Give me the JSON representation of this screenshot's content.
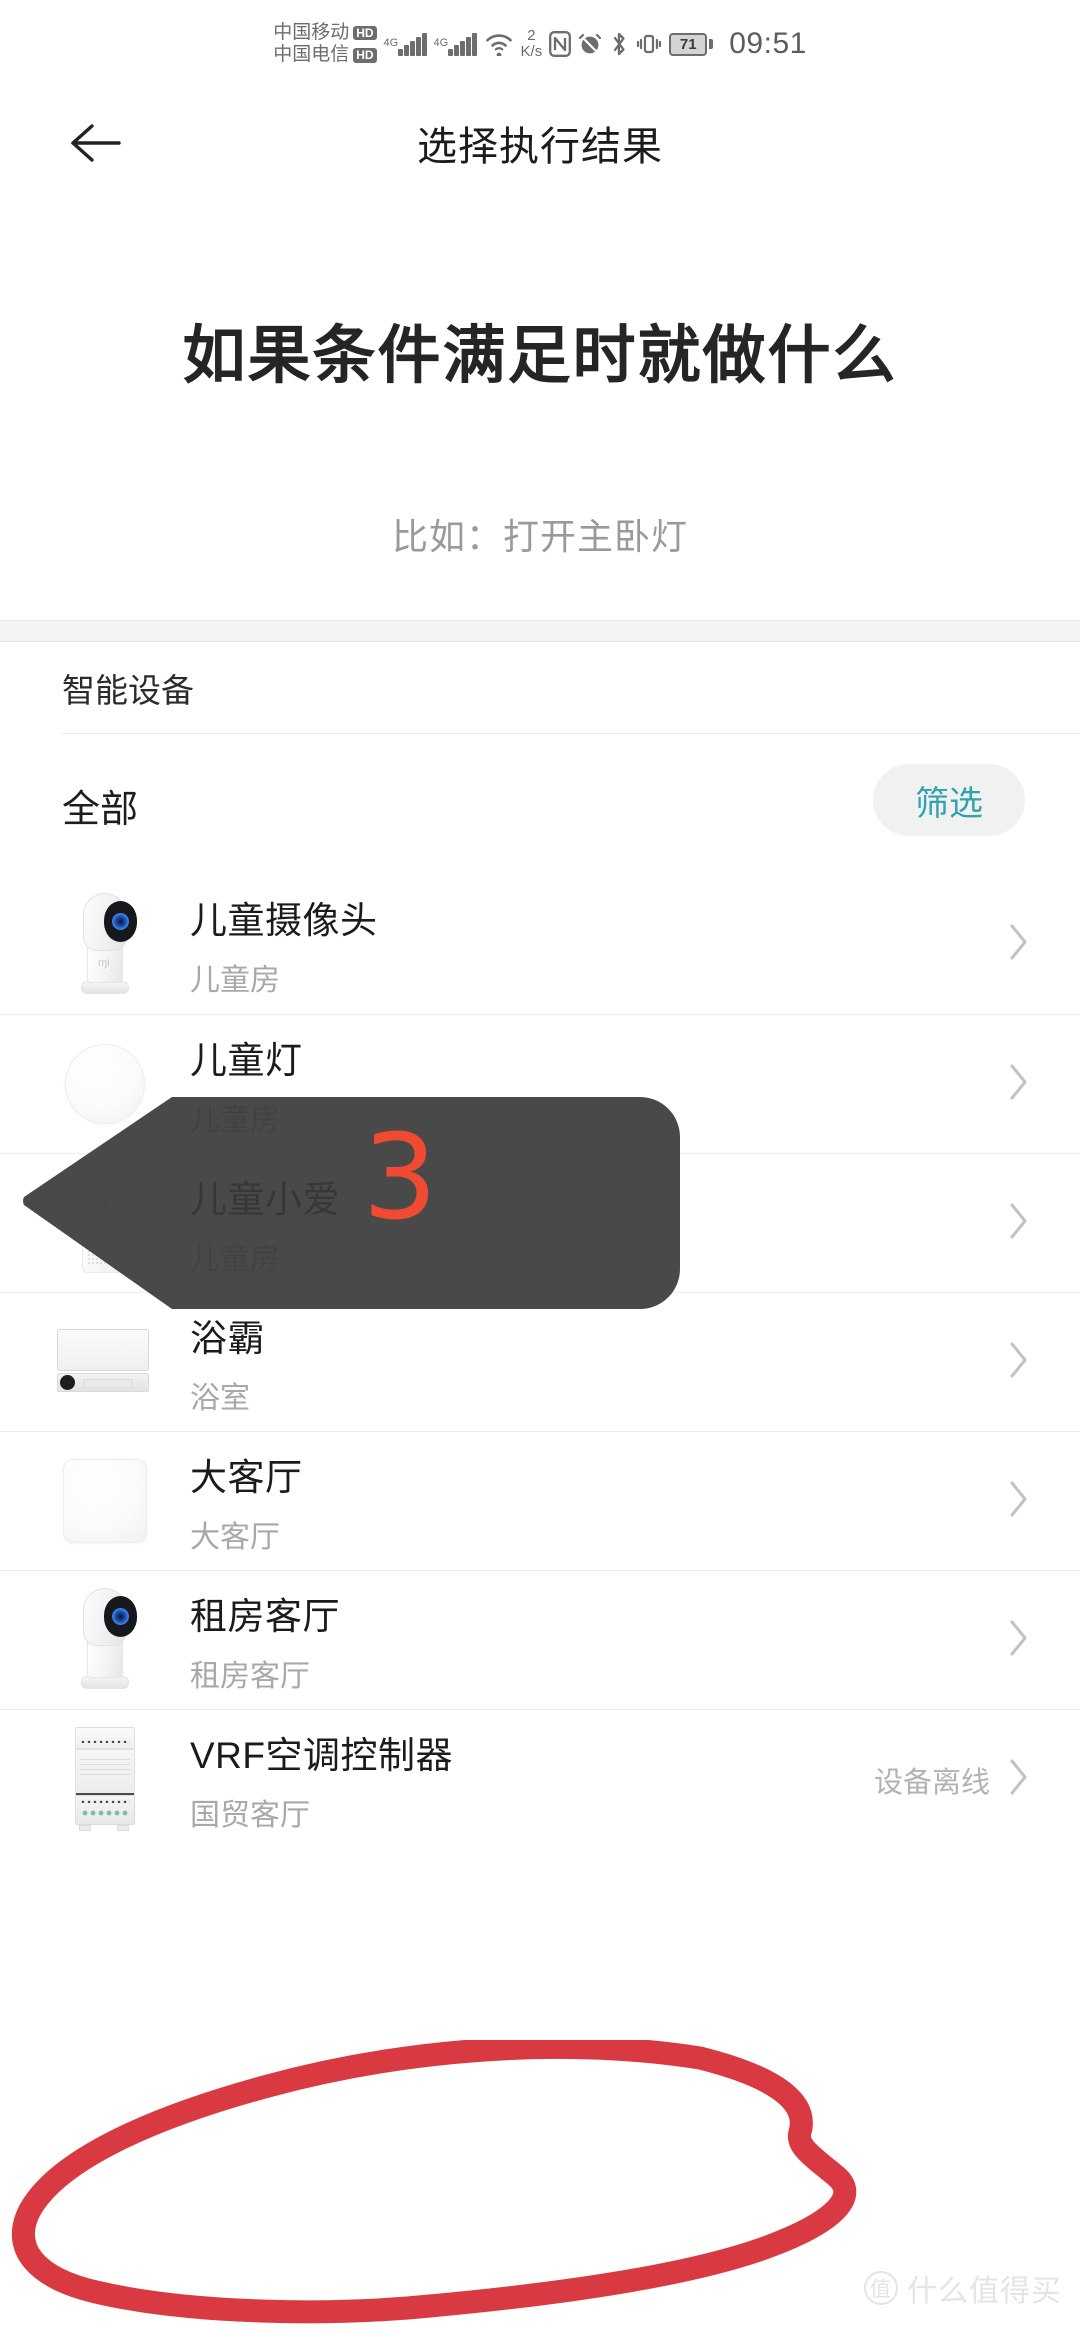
{
  "status_bar": {
    "carrier_primary": "中国移动",
    "carrier_primary_badge": "HD",
    "carrier_secondary": "中国电信",
    "carrier_secondary_badge": "HD",
    "network_primary": "4G",
    "network_secondary": "4G",
    "data_rate_value": "2",
    "data_rate_unit": "K/s",
    "battery_percent": "71",
    "clock": "09:51",
    "icons": [
      "nfc-icon",
      "alarm-mute-icon",
      "bluetooth-icon",
      "vibrate-icon",
      "battery-icon"
    ]
  },
  "nav": {
    "back_label": "back-arrow-icon",
    "title": "选择执行结果"
  },
  "hero": {
    "title": "如果条件满足时就做什么",
    "subtitle": "比如：打开主卧灯"
  },
  "section": {
    "label": "智能设备"
  },
  "filter": {
    "all_label": "全部",
    "button_label": "筛选",
    "button_text_color": "#33a2ac",
    "button_bg_color": "#f0f2f2"
  },
  "devices": [
    {
      "name": "儿童摄像头",
      "room": "儿童房",
      "status": "",
      "icon": "camera-icon"
    },
    {
      "name": "儿童灯",
      "room": "儿童房",
      "status": "",
      "icon": "lamp-icon"
    },
    {
      "name": "儿童小爱",
      "room": "儿童房",
      "status": "",
      "icon": "speaker-icon"
    },
    {
      "name": "浴霸",
      "room": "浴室",
      "status": "",
      "icon": "bath-heater-icon"
    },
    {
      "name": "大客厅",
      "room": "大客厅",
      "status": "",
      "icon": "placeholder-icon"
    },
    {
      "name": "租房客厅",
      "room": "租房客厅",
      "status": "",
      "icon": "camera-icon"
    },
    {
      "name": "VRF空调控制器",
      "room": "国贸客厅",
      "status": "设备离线",
      "icon": "controller-module-icon"
    }
  ],
  "annotations": {
    "step_number": "3",
    "step_number_color": "#f04a32",
    "callout_bg_color": "#3a3a3a",
    "circle_color": "#d93a41"
  },
  "watermark": {
    "mark": "值",
    "text": "什么值得买"
  }
}
